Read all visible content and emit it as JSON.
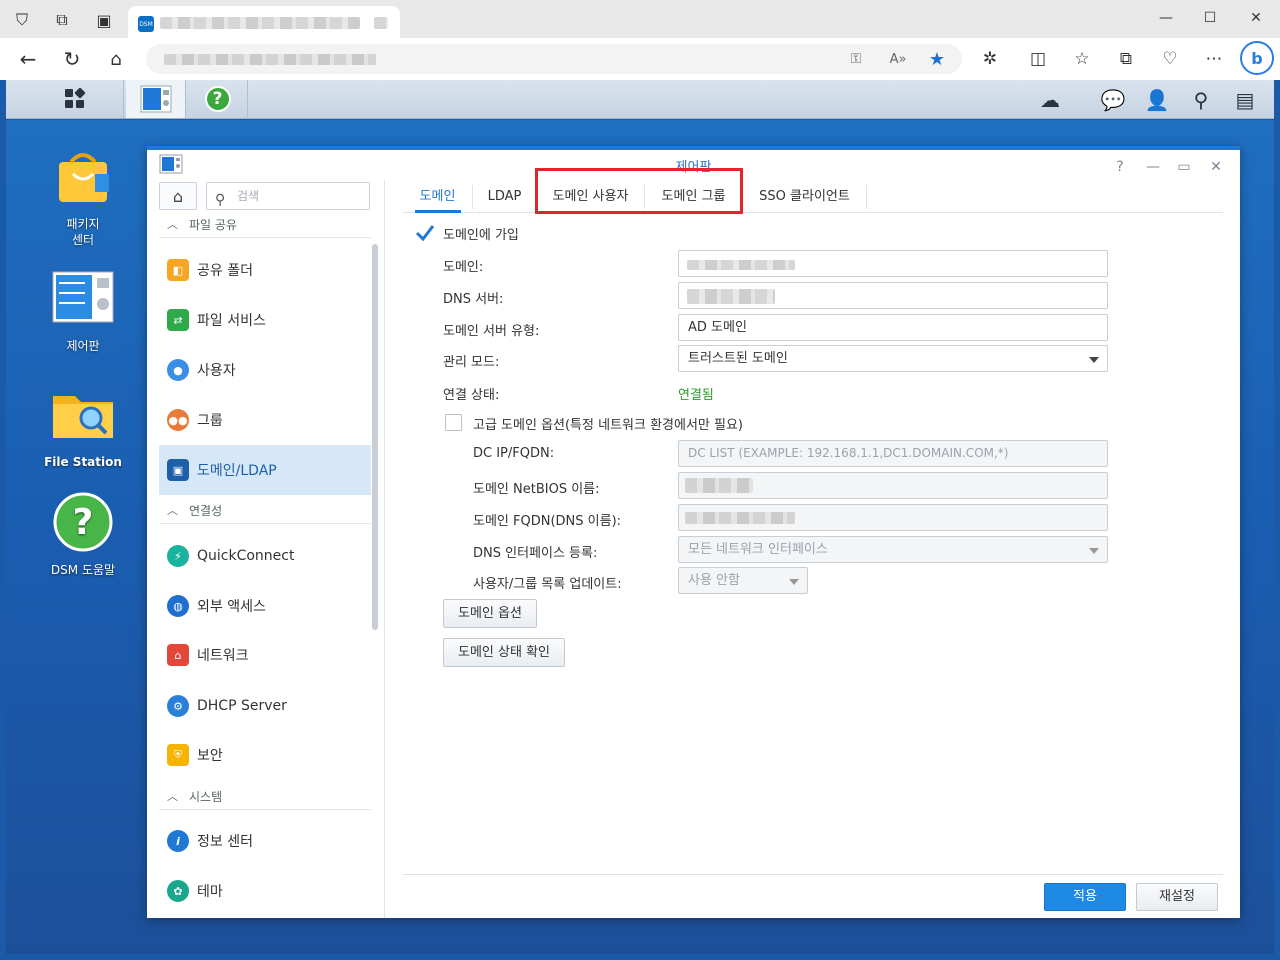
{
  "browser": {
    "toolbar_icons": [
      "back-icon",
      "refresh-icon",
      "home-icon",
      "key-icon",
      "read-aloud-icon",
      "favorite-star-icon",
      "extensions-icon",
      "split-screen-icon",
      "favorites-icon",
      "collections-icon",
      "performance-icon",
      "more-icon",
      "bing-icon"
    ],
    "window_controls": {
      "minimize": "—",
      "maximize": "☐",
      "close": "✕"
    }
  },
  "dsm_bar": {
    "right_icons": [
      "cloud-sync-icon",
      "chat-icon",
      "user-icon",
      "search-icon",
      "widgets-icon"
    ]
  },
  "desktop": {
    "icons": [
      {
        "label": "패키지\n센터",
        "name": "package-center"
      },
      {
        "label": "제어판",
        "name": "control-panel"
      },
      {
        "label": "File Station",
        "name": "file-station"
      },
      {
        "label": "DSM 도움말",
        "name": "dsm-help"
      }
    ]
  },
  "window": {
    "title": "제어판",
    "controls": {
      "help": "?",
      "minimize": "—",
      "maximize": "▭",
      "close": "✕"
    }
  },
  "sidebar": {
    "search_placeholder": "검색",
    "sections": [
      {
        "label": "파일 공유"
      },
      {
        "label": "연결성"
      },
      {
        "label": "시스템"
      }
    ],
    "items": [
      {
        "label": "공유 폴더",
        "color": "#f5a623"
      },
      {
        "label": "파일 서비스",
        "color": "#2eaa4a"
      },
      {
        "label": "사용자",
        "color": "#3a8ee6"
      },
      {
        "label": "그룹",
        "color": "#e87a3a"
      },
      {
        "label": "도메인/LDAP",
        "color": "#1d5fa8"
      },
      {
        "label": "QuickConnect",
        "color": "#19b3a0"
      },
      {
        "label": "외부 액세스",
        "color": "#1e6fd0"
      },
      {
        "label": "네트워크",
        "color": "#e2483a"
      },
      {
        "label": "DHCP Server",
        "color": "#2b7fd8"
      },
      {
        "label": "보안",
        "color": "#f4b400"
      },
      {
        "label": "정보 센터",
        "color": "#1e78d4"
      },
      {
        "label": "테마",
        "color": "#19a88e"
      }
    ]
  },
  "tabs": [
    "도메인",
    "LDAP",
    "도메인 사용자",
    "도메인 그룹",
    "SSO 클라이언트"
  ],
  "form": {
    "join_domain_label": "도메인에 가입",
    "domain_label": "도메인:",
    "dns_server_label": "DNS 서버:",
    "server_type_label": "도메인 서버 유형:",
    "server_type_value": "AD 도메인",
    "manage_mode_label": "관리 모드:",
    "manage_mode_value": "트러스트된 도메인",
    "conn_status_label": "연결 상태:",
    "conn_status_value": "연결됨",
    "conn_status_color": "#2e9a2e",
    "advanced_label": "고급 도메인 옵션(특정 네트워크 환경에서만 필요)",
    "dc_label": "DC IP/FQDN:",
    "dc_placeholder": "DC LIST (EXAMPLE: 192.168.1.1,DC1.DOMAIN.COM,*)",
    "netbios_label": "도메인 NetBIOS 이름:",
    "fqdn_label": "도메인 FQDN(DNS 이름):",
    "dns_reg_label": "DNS 인터페이스 등록:",
    "dns_reg_value": "모든 네트워크 인터페이스",
    "update_label": "사용자/그룹 목록 업데이트:",
    "update_value": "사용 안함",
    "domain_options_btn": "도메인 옵션",
    "check_status_btn": "도메인 상태 확인"
  },
  "footer": {
    "apply": "적용",
    "reset": "재설정"
  },
  "colors": {
    "accent": "#1e78d4",
    "highlight_box": "#e0262c"
  }
}
